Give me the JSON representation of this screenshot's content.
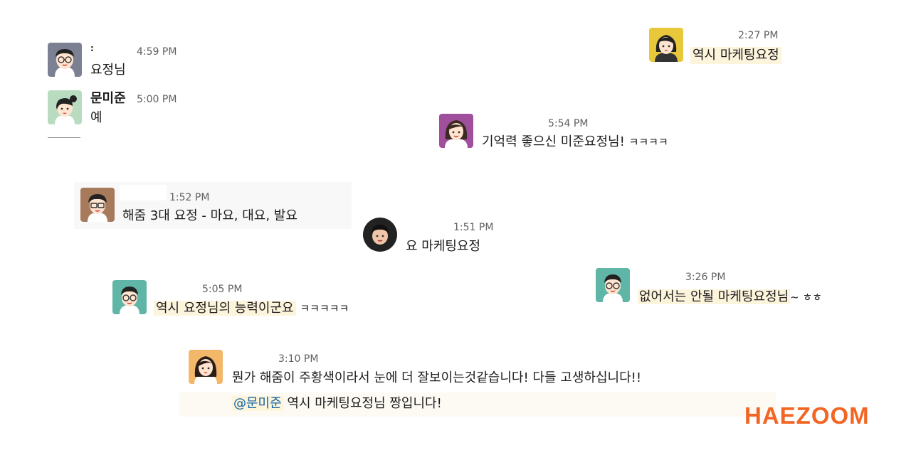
{
  "messages": [
    {
      "id": "m1",
      "avatar_icon": "man-glasses-avatar-icon",
      "name": ":",
      "time": "4:59 PM",
      "text": "요정님"
    },
    {
      "id": "m2",
      "avatar_icon": "woman-bun-avatar-icon",
      "name": "문미준",
      "time": "5:00 PM",
      "text": "예"
    },
    {
      "id": "m3",
      "avatar_icon": "woman-yellow-avatar-icon",
      "time": "2:27 PM",
      "text": "역시 마케팅요정"
    },
    {
      "id": "m4",
      "avatar_icon": "woman-purple-avatar-icon",
      "time": "5:54 PM",
      "text_main": "기억력 좋으신 미준요정님!",
      "text_suffix": "ㅋㅋㅋㅋ"
    },
    {
      "id": "m5",
      "avatar_icon": "man-brown-avatar-icon",
      "time": "1:52 PM",
      "text": "해줌 3대 요정 - 마요, 대요, 발요"
    },
    {
      "id": "m6",
      "avatar_icon": "man-black-round-avatar-icon",
      "time": "1:51 PM",
      "text": "요 마케팅요정"
    },
    {
      "id": "m7",
      "avatar_icon": "man-teal-glasses-avatar-icon",
      "time": "5:05 PM",
      "text_main": "역시 요정님의 능력이군요",
      "text_suffix": "ㅋㅋㅋㅋㅋ"
    },
    {
      "id": "m8",
      "avatar_icon": "man-teal2-glasses-avatar-icon",
      "time": "3:26 PM",
      "text_main": "없어서는 안될 마케팅요정님",
      "text_suffix": "~ ㅎㅎ"
    },
    {
      "id": "m9",
      "avatar_icon": "woman-orange-avatar-icon",
      "time": "3:10 PM",
      "text": "뭔가 해줌이 주황색이라서 눈에 더 잘보이는것같습니다! 다들 고생하십니다!!",
      "mention": "@문미준",
      "text2": "역시 마케팅요정님 짱입니다!"
    }
  ],
  "brand": {
    "logo_text": "HAEZOOM",
    "accent_color": "#f26522",
    "highlight_color": "#fdf4dc",
    "mention_color": "#1264a3"
  }
}
